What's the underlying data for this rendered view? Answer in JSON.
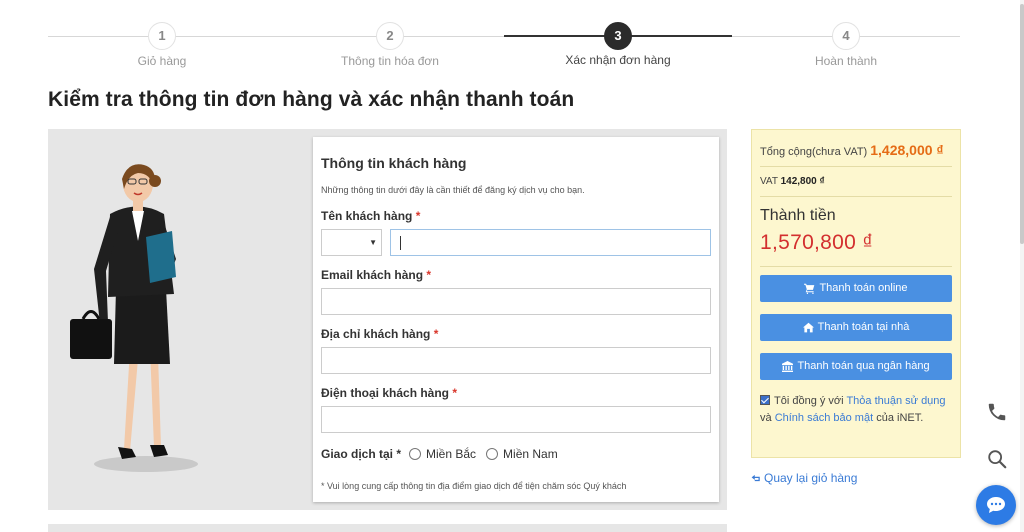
{
  "stepper": {
    "steps": [
      {
        "number": "1",
        "label": "Giỏ hàng"
      },
      {
        "number": "2",
        "label": "Thông tin hóa đơn"
      },
      {
        "number": "3",
        "label": "Xác nhận đơn hàng"
      },
      {
        "number": "4",
        "label": "Hoàn thành"
      }
    ],
    "active_step": 3
  },
  "page_title": "Kiểm tra thông tin đơn hàng và xác nhận thanh toán",
  "form": {
    "title": "Thông tin khách hàng",
    "description": "Những thông tin dưới đây là cần thiết để đăng ký dịch vụ cho bạn.",
    "required_mark": "*",
    "name_label": "Tên khách hàng",
    "name_value": "",
    "title_select_value": "",
    "email_label": "Email khách hàng",
    "email_value": "",
    "address_label": "Địa chỉ khách hàng",
    "address_value": "",
    "phone_label": "Điện thoại khách hàng",
    "phone_value": "",
    "transaction_label": "Giao dịch tại *",
    "options": [
      "Miền Bắc",
      "Miền Nam"
    ],
    "note": "* Vui lòng cung cấp thông tin địa điểm giao dịch để tiện chăm sóc Quý khách"
  },
  "summary": {
    "subtotal_label": "Tổng cộng(chưa VAT)",
    "subtotal_value": "1,428,000 ₫",
    "vat_label": "VAT",
    "vat_value": "142,800 ₫",
    "total_label": "Thành tiền",
    "total_value": "1,570,800 ₫",
    "pay_online": "Thanh toán online",
    "pay_home": "Thanh toán tại nhà",
    "pay_bank": "Thanh toán qua ngân hàng",
    "agree_prefix": "Tôi đồng ý với",
    "agree_terms": "Thỏa thuận sử dụng",
    "agree_and": "và",
    "agree_privacy": "Chính sách bảo mật",
    "agree_suffix": "của iNET.",
    "agree_checked": true
  },
  "back_link": "Quay lại giỏ hàng",
  "colors": {
    "accent_blue": "#4a90e2",
    "price_red": "#d32f2f",
    "price_orange": "#e56c16",
    "summary_bg": "#fdf7cf",
    "chat_button": "#2d7be5"
  },
  "icons": {
    "cart": "cart-icon",
    "home": "home-icon",
    "bank": "bank-icon",
    "back": "return-icon",
    "phone": "phone-icon",
    "search": "search-icon",
    "chat": "chat-icon"
  }
}
